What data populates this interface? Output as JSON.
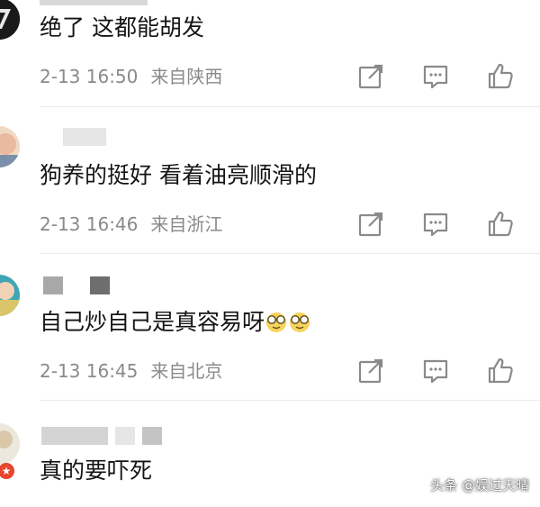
{
  "comments": [
    {
      "text": "绝了 这都能胡发",
      "time": "2-13 16:50",
      "location": "来自陕西"
    },
    {
      "text": "狗养的挺好  看着油亮顺滑的",
      "time": "2-13 16:46",
      "location": "来自浙江"
    },
    {
      "text": "自己炒自己是真容易呀",
      "time": "2-13 16:45",
      "location": "来自北京",
      "emojis": [
        "glasses-face-emoji",
        "glasses-face-emoji"
      ]
    },
    {
      "text": "真的要吓死"
    }
  ],
  "watermark": "头条 @娱过天晴",
  "icons": [
    "share-icon",
    "reply-icon",
    "like-icon"
  ],
  "colors": {
    "meta_text": "#8a8a8a",
    "icon": "#8a8a8a",
    "divider": "#ececec"
  }
}
